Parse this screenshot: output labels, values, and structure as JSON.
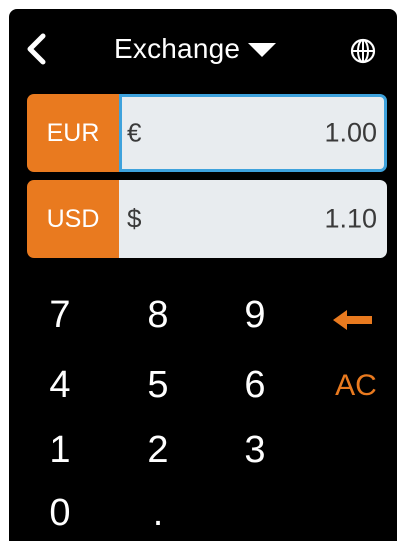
{
  "header": {
    "back_icon": "chevron-left-icon",
    "title": "Exchange",
    "dropdown_icon": "caret-down-icon",
    "globe_icon": "globe-icon"
  },
  "currencies": [
    {
      "code": "EUR",
      "symbol": "€",
      "amount": "1.00",
      "active": true
    },
    {
      "code": "USD",
      "symbol": "$",
      "amount": "1.10",
      "active": false
    }
  ],
  "keypad": {
    "keys": [
      "7",
      "8",
      "9",
      "4",
      "5",
      "6",
      "1",
      "2",
      "3",
      "0",
      "."
    ],
    "backspace_icon": "backspace-arrow-icon",
    "clear_label": "AC"
  },
  "colors": {
    "accent": "#e97a1f",
    "background": "#000000",
    "field": "#e8ecef",
    "active_border": "#3ea2dc"
  }
}
